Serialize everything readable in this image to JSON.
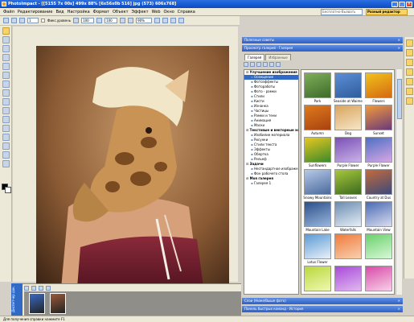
{
  "window": {
    "title": "PhotoImpact - [[5155 7x 00s] 499x 88% [6x56x0b 516] jpg (573) 606x768]",
    "buttons": [
      "_",
      "□",
      "×"
    ]
  },
  "menu": {
    "items": [
      "Файл",
      "Редактирование",
      "Вид",
      "Настройка",
      "Формат",
      "Объект",
      "Эффект",
      "Web",
      "Окно",
      "Справка"
    ],
    "search_value": "Бесплатно-Вызвать",
    "mode_button": "Разный редактор"
  },
  "toolbar": {
    "brush_size": "1",
    "checkbox_label": "Фикс.уровень",
    "field1": "100",
    "field2": "100",
    "zoom": "90%"
  },
  "panels": {
    "top_header": "Полезные советы",
    "gallery_header": "Просмотр галерей - Галерея",
    "bottom_header1": "Слои (Ниже/Выше фото)",
    "bottom_header2": "Панель быстрых команд - История"
  },
  "gallery": {
    "tabs": [
      "Галерея",
      "Избранные"
    ],
    "tree": [
      {
        "kind": "grp",
        "label": "Улучшение изображения"
      },
      {
        "kind": "itm",
        "label": "Освещение",
        "selected": true
      },
      {
        "kind": "itm",
        "label": "Фотоэффекты"
      },
      {
        "kind": "itm",
        "label": "Фотоработы"
      },
      {
        "kind": "itm",
        "label": "Фото - рамки"
      },
      {
        "kind": "itm",
        "label": "Стили"
      },
      {
        "kind": "itm",
        "label": "Кисти"
      },
      {
        "kind": "itm",
        "label": "Изнанка"
      },
      {
        "kind": "itm",
        "label": "Частицы"
      },
      {
        "kind": "itm",
        "label": "Рамки и тени"
      },
      {
        "kind": "itm",
        "label": "Анимация"
      },
      {
        "kind": "itm",
        "label": "Маски"
      },
      {
        "kind": "grp",
        "label": "Текстовые и векторные эф"
      },
      {
        "kind": "itm",
        "label": "Изобилие материала"
      },
      {
        "kind": "itm",
        "label": "Рисунки"
      },
      {
        "kind": "itm",
        "label": "Стили текста"
      },
      {
        "kind": "itm",
        "label": "Эффекты"
      },
      {
        "kind": "itm",
        "label": "Обертка"
      },
      {
        "kind": "itm",
        "label": "Рельеф"
      },
      {
        "kind": "grp",
        "label": "Задачи"
      },
      {
        "kind": "itm",
        "label": "Нестандартное изображен"
      },
      {
        "kind": "itm",
        "label": "Фон рабочего стола"
      },
      {
        "kind": "grp",
        "label": "Моя галерея"
      },
      {
        "kind": "itm",
        "label": "Галерея 1"
      }
    ],
    "thumbs": [
      {
        "caption": "Park",
        "colors": [
          "#7fae5a",
          "#3d6b2a"
        ]
      },
      {
        "caption": "Seaside at Waimea",
        "colors": [
          "#5d8ed6",
          "#2f5d9c"
        ]
      },
      {
        "caption": "Flowers",
        "colors": [
          "#f2c21b",
          "#d46a12"
        ]
      },
      {
        "caption": "Autumn",
        "colors": [
          "#e07a1c",
          "#a84210"
        ]
      },
      {
        "caption": "Dog",
        "colors": [
          "#d9a45c",
          "#f6e6c8"
        ]
      },
      {
        "caption": "Sunset",
        "colors": [
          "#f39a3a",
          "#6a3a7a"
        ]
      },
      {
        "caption": "Sunflowers",
        "colors": [
          "#e8c81f",
          "#3c8a2c"
        ]
      },
      {
        "caption": "Purple Flower",
        "colors": [
          "#7a4fb5",
          "#c9b2e8"
        ]
      },
      {
        "caption": "Purple Flower",
        "colors": [
          "#4c6fc4",
          "#d8a6e4"
        ]
      },
      {
        "caption": "Snowy Mountains",
        "colors": [
          "#b7c9e8",
          "#4a6a9c"
        ]
      },
      {
        "caption": "Tall Leaves",
        "colors": [
          "#a8c83c",
          "#3c6a1e"
        ]
      },
      {
        "caption": "Country at Dus",
        "colors": [
          "#c46a3c",
          "#3c4a7a"
        ]
      },
      {
        "caption": "Mountain Lake",
        "colors": [
          "#2a4f8a",
          "#9bb6dc"
        ]
      },
      {
        "caption": "Waterfalls",
        "colors": [
          "#6a8cb0",
          "#e6eef6"
        ]
      },
      {
        "caption": "Mountain View",
        "colors": [
          "#4a6ab4",
          "#d8dcee"
        ]
      },
      {
        "caption": "Lotus Flower",
        "colors": [
          "#5a9ad4",
          "#e8f0f8"
        ]
      },
      {
        "caption": "",
        "colors": [
          "#f07a3a",
          "#f8d0b0"
        ]
      },
      {
        "caption": "",
        "colors": [
          "#6ad06a",
          "#d8f8d8"
        ]
      },
      {
        "caption": "",
        "colors": [
          "#b8d83c",
          "#f0f8b0"
        ]
      },
      {
        "caption": "",
        "colors": [
          "#a84ad8",
          "#e0b8f0"
        ]
      },
      {
        "caption": "",
        "colors": [
          "#d84aa8",
          "#f8d0e8"
        ]
      }
    ]
  },
  "bottom": {
    "vertical_tab": "Диспетчер док.",
    "film_colors": [
      "#3a6ac4",
      "#9a5a3a"
    ]
  },
  "status": {
    "text": "Для получения справки нажмите F1"
  },
  "colors": {
    "title_bar": "#0a4bc4",
    "canvas_bg": "#ece9d8",
    "selection": "#316ac5"
  }
}
